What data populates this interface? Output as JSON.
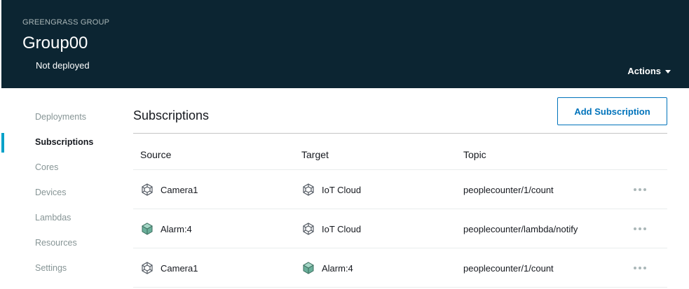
{
  "header": {
    "eyebrow": "GREENGRASS GROUP",
    "group_name": "Group00",
    "status": "Not deployed",
    "actions_label": "Actions"
  },
  "sidebar": {
    "items": [
      {
        "label": "Deployments"
      },
      {
        "label": "Subscriptions",
        "active": true
      },
      {
        "label": "Cores"
      },
      {
        "label": "Devices"
      },
      {
        "label": "Lambdas"
      },
      {
        "label": "Resources"
      },
      {
        "label": "Settings"
      }
    ]
  },
  "main": {
    "title": "Subscriptions",
    "add_button": "Add Subscription",
    "columns": {
      "source": "Source",
      "target": "Target",
      "topic": "Topic"
    },
    "rows": [
      {
        "source": "Camera1",
        "source_icon": "device-icon",
        "target": "IoT Cloud",
        "target_icon": "device-icon",
        "topic": "peoplecounter/1/count"
      },
      {
        "source": "Alarm:4",
        "source_icon": "lambda-cube-icon",
        "target": "IoT Cloud",
        "target_icon": "device-icon",
        "topic": "peoplecounter/lambda/notify"
      },
      {
        "source": "Camera1",
        "source_icon": "device-icon",
        "target": "Alarm:4",
        "target_icon": "lambda-cube-icon",
        "topic": "peoplecounter/1/count"
      }
    ]
  },
  "colors": {
    "header_bg": "#0c2532",
    "accent": "#00a1c9",
    "link": "#0073bb",
    "cube": "#6aaf9a"
  }
}
